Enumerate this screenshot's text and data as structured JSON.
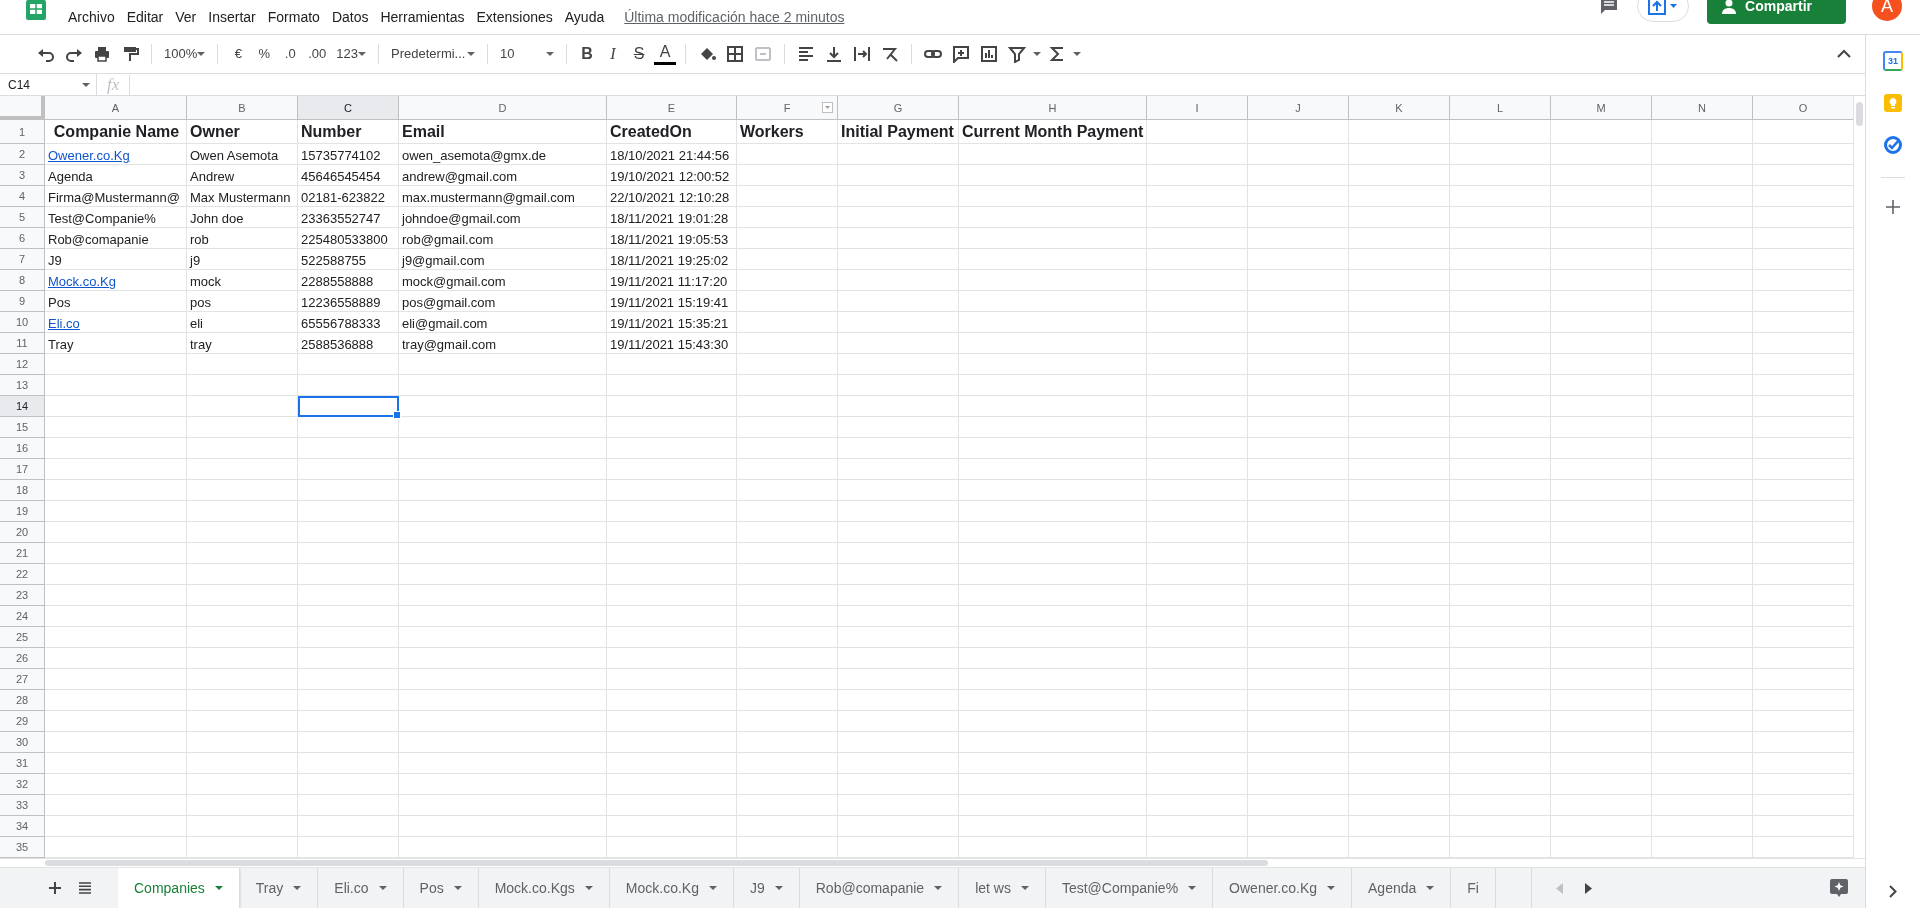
{
  "menu": [
    "Archivo",
    "Editar",
    "Ver",
    "Insertar",
    "Formato",
    "Datos",
    "Herramientas",
    "Extensiones",
    "Ayuda"
  ],
  "last_edit": "Última modificación hace 2 minutos",
  "share_button": "Compartir",
  "avatar": "A",
  "toolbar": {
    "zoom": "100%",
    "currency": "€",
    "percent": "%",
    "decrease_decimals": ".0",
    "increase_decimals": ".00",
    "number_format": "123",
    "font": "Predetermi...",
    "font_size": "10",
    "bold": "B",
    "italic": "I",
    "strikethrough": "S",
    "text_color": "A"
  },
  "formula_bar": {
    "name_box": "C14",
    "fx": "fx"
  },
  "side_panel": {
    "calendar_day": "31"
  },
  "columns": [
    {
      "label": "A",
      "selected": false,
      "filter": false
    },
    {
      "label": "B",
      "selected": false,
      "filter": false
    },
    {
      "label": "C",
      "selected": true,
      "filter": false
    },
    {
      "label": "D",
      "selected": false,
      "filter": false
    },
    {
      "label": "E",
      "selected": false,
      "filter": false
    },
    {
      "label": "F",
      "selected": false,
      "filter": true
    },
    {
      "label": "G",
      "selected": false,
      "filter": false
    },
    {
      "label": "H",
      "selected": false,
      "filter": false
    },
    {
      "label": "I",
      "selected": false,
      "filter": false
    },
    {
      "label": "J",
      "selected": false,
      "filter": false
    },
    {
      "label": "K",
      "selected": false,
      "filter": false
    },
    {
      "label": "L",
      "selected": false,
      "filter": false
    },
    {
      "label": "M",
      "selected": false,
      "filter": false
    },
    {
      "label": "N",
      "selected": false,
      "filter": false
    },
    {
      "label": "O",
      "selected": false,
      "filter": false
    }
  ],
  "rows": [
    {
      "number": "1",
      "kind": "header",
      "selected": false,
      "cells": [
        {
          "text": "Companie Name"
        },
        {
          "text": "Owner"
        },
        {
          "text": "Number"
        },
        {
          "text": "Email"
        },
        {
          "text": "CreatedOn"
        },
        {
          "text": "Workers"
        },
        {
          "text": "Initial Payment"
        },
        {
          "text": "Current Month Payment"
        }
      ]
    },
    {
      "number": "2",
      "kind": "data",
      "selected": false,
      "cells": [
        {
          "text": "Owener.co.Kg",
          "link": true
        },
        {
          "text": "Owen Asemota"
        },
        {
          "text": "15735774102"
        },
        {
          "text": "owen_asemota@gmx.de"
        },
        {
          "text": "18/10/2021 21:44:56"
        }
      ]
    },
    {
      "number": "3",
      "kind": "data",
      "selected": false,
      "cells": [
        {
          "text": "Agenda"
        },
        {
          "text": "Andrew"
        },
        {
          "text": "45646545454"
        },
        {
          "text": "andrew@gmail.com"
        },
        {
          "text": "19/10/2021 12:00:52"
        }
      ]
    },
    {
      "number": "4",
      "kind": "data",
      "selected": false,
      "cells": [
        {
          "text": "Firma@Mustermann@"
        },
        {
          "text": "Max Mustermann"
        },
        {
          "text": "02181-623822"
        },
        {
          "text": "max.mustermann@gmail.com"
        },
        {
          "text": "22/10/2021 12:10:28"
        }
      ]
    },
    {
      "number": "5",
      "kind": "data",
      "selected": false,
      "cells": [
        {
          "text": "Test@Companie%"
        },
        {
          "text": "John doe"
        },
        {
          "text": "23363552747"
        },
        {
          "text": "johndoe@gmail.com"
        },
        {
          "text": "18/11/2021 19:01:28"
        }
      ]
    },
    {
      "number": "6",
      "kind": "data",
      "selected": false,
      "cells": [
        {
          "text": "Rob@comapanie"
        },
        {
          "text": "rob"
        },
        {
          "text": "225480533800"
        },
        {
          "text": "rob@gmail.com"
        },
        {
          "text": "18/11/2021 19:05:53"
        }
      ]
    },
    {
      "number": "7",
      "kind": "data",
      "selected": false,
      "cells": [
        {
          "text": "J9"
        },
        {
          "text": "j9"
        },
        {
          "text": "522588755"
        },
        {
          "text": "j9@gmail.com"
        },
        {
          "text": "18/11/2021 19:25:02"
        }
      ]
    },
    {
      "number": "8",
      "kind": "data",
      "selected": false,
      "cells": [
        {
          "text": "Mock.co.Kg",
          "link": true
        },
        {
          "text": "mock"
        },
        {
          "text": "2288558888"
        },
        {
          "text": "mock@gmail.com"
        },
        {
          "text": "19/11/2021 11:17:20"
        }
      ]
    },
    {
      "number": "9",
      "kind": "data",
      "selected": false,
      "cells": [
        {
          "text": "Pos"
        },
        {
          "text": "pos"
        },
        {
          "text": "12236558889"
        },
        {
          "text": "pos@gmail.com"
        },
        {
          "text": "19/11/2021 15:19:41"
        }
      ]
    },
    {
      "number": "10",
      "kind": "data",
      "selected": false,
      "cells": [
        {
          "text": "Eli.co",
          "link": true
        },
        {
          "text": "eli"
        },
        {
          "text": "65556788333"
        },
        {
          "text": "eli@gmail.com"
        },
        {
          "text": "19/11/2021 15:35:21"
        }
      ]
    },
    {
      "number": "11",
      "kind": "data",
      "selected": false,
      "cells": [
        {
          "text": "Tray"
        },
        {
          "text": "tray"
        },
        {
          "text": "2588536888"
        },
        {
          "text": "tray@gmail.com"
        },
        {
          "text": "19/11/2021 15:43:30"
        }
      ]
    },
    {
      "number": "12",
      "kind": "data",
      "selected": false,
      "cells": []
    },
    {
      "number": "13",
      "kind": "data",
      "selected": false,
      "cells": []
    },
    {
      "number": "14",
      "kind": "data",
      "selected": true,
      "cells": []
    },
    {
      "number": "15",
      "kind": "data",
      "selected": false,
      "cells": []
    },
    {
      "number": "16",
      "kind": "data",
      "selected": false,
      "cells": []
    },
    {
      "number": "17",
      "kind": "data",
      "selected": false,
      "cells": []
    },
    {
      "number": "18",
      "kind": "data",
      "selected": false,
      "cells": []
    },
    {
      "number": "19",
      "kind": "data",
      "selected": false,
      "cells": []
    },
    {
      "number": "20",
      "kind": "data",
      "selected": false,
      "cells": []
    },
    {
      "number": "21",
      "kind": "data",
      "selected": false,
      "cells": []
    },
    {
      "number": "22",
      "kind": "data",
      "selected": false,
      "cells": []
    },
    {
      "number": "23",
      "kind": "data",
      "selected": false,
      "cells": []
    },
    {
      "number": "24",
      "kind": "data",
      "selected": false,
      "cells": []
    },
    {
      "number": "25",
      "kind": "data",
      "selected": false,
      "cells": []
    },
    {
      "number": "26",
      "kind": "data",
      "selected": false,
      "cells": []
    },
    {
      "number": "27",
      "kind": "data",
      "selected": false,
      "cells": []
    },
    {
      "number": "28",
      "kind": "data",
      "selected": false,
      "cells": []
    },
    {
      "number": "29",
      "kind": "data",
      "selected": false,
      "cells": []
    },
    {
      "number": "30",
      "kind": "data",
      "selected": false,
      "cells": []
    },
    {
      "number": "31",
      "kind": "data",
      "selected": false,
      "cells": []
    },
    {
      "number": "32",
      "kind": "data",
      "selected": false,
      "cells": []
    },
    {
      "number": "33",
      "kind": "data",
      "selected": false,
      "cells": []
    },
    {
      "number": "34",
      "kind": "data",
      "selected": false,
      "cells": []
    },
    {
      "number": "35",
      "kind": "data",
      "selected": false,
      "cells": []
    }
  ],
  "sheet_tabs": [
    {
      "label": "Companies",
      "selected": true
    },
    {
      "label": "Tray",
      "selected": false
    },
    {
      "label": "Eli.co",
      "selected": false
    },
    {
      "label": "Pos",
      "selected": false
    },
    {
      "label": "Mock.co.Kgs",
      "selected": false
    },
    {
      "label": "Mock.co.Kg",
      "selected": false
    },
    {
      "label": "J9",
      "selected": false
    },
    {
      "label": "Rob@comapanie",
      "selected": false
    },
    {
      "label": "let ws",
      "selected": false
    },
    {
      "label": "Test@Companie%",
      "selected": false
    },
    {
      "label": "Owener.co.Kg",
      "selected": false
    },
    {
      "label": "Agenda",
      "selected": false
    },
    {
      "label": "Fi",
      "selected": false
    }
  ]
}
